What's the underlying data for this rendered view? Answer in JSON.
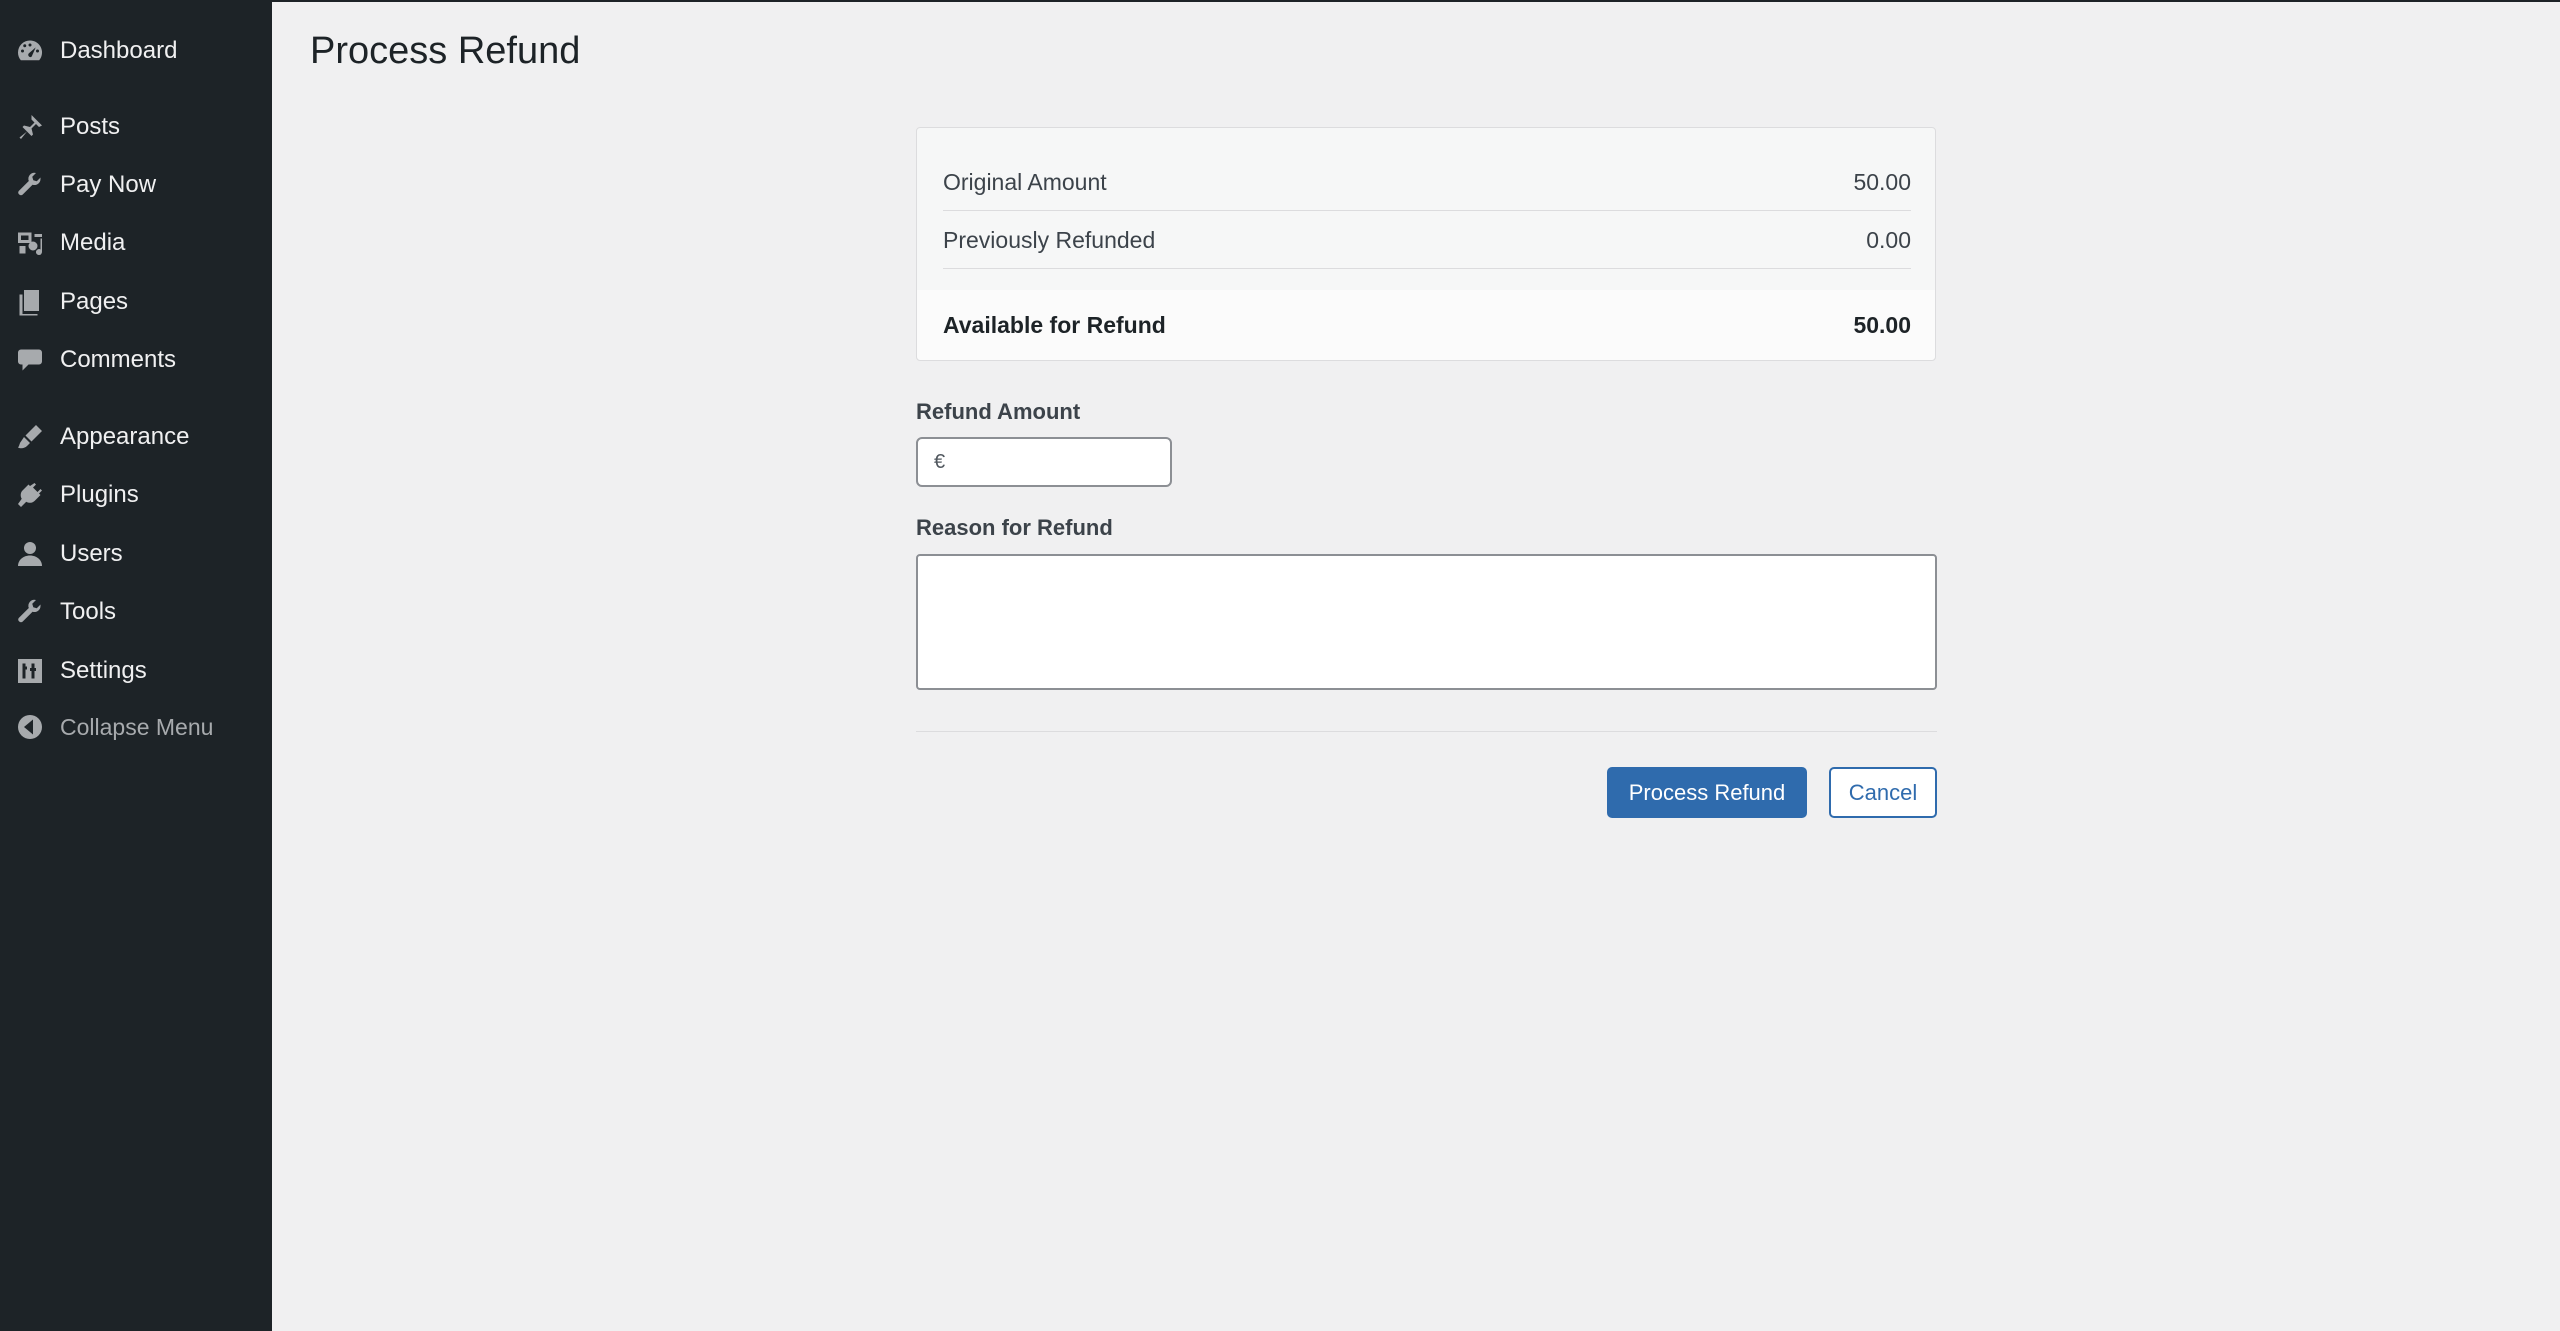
{
  "sidebar": {
    "items": [
      {
        "label": "Dashboard",
        "icon": "dashboard-icon"
      },
      {
        "label": "Posts",
        "icon": "pin-icon"
      },
      {
        "label": "Pay Now",
        "icon": "wrench-icon"
      },
      {
        "label": "Media",
        "icon": "media-icon"
      },
      {
        "label": "Pages",
        "icon": "pages-icon"
      },
      {
        "label": "Comments",
        "icon": "comment-icon"
      },
      {
        "label": "Appearance",
        "icon": "brush-icon"
      },
      {
        "label": "Plugins",
        "icon": "plug-icon"
      },
      {
        "label": "Users",
        "icon": "user-icon"
      },
      {
        "label": "Tools",
        "icon": "wrench-icon"
      },
      {
        "label": "Settings",
        "icon": "sliders-icon"
      },
      {
        "label": "Collapse Menu",
        "icon": "collapse-arrow-icon"
      }
    ]
  },
  "page": {
    "title": "Process Refund"
  },
  "summary": {
    "original_label": "Original Amount",
    "original_value": "50.00",
    "refunded_label": "Previously Refunded",
    "refunded_value": "0.00",
    "available_label": "Available for Refund",
    "available_value": "50.00"
  },
  "form": {
    "amount_label": "Refund Amount",
    "currency_symbol": "€",
    "amount_value": "",
    "reason_label": "Reason for Refund",
    "reason_value": ""
  },
  "actions": {
    "submit_label": "Process Refund",
    "cancel_label": "Cancel"
  },
  "colors": {
    "sidebar_bg": "#1d2327",
    "page_bg": "#f0f0f1",
    "primary": "#2f6bad"
  }
}
